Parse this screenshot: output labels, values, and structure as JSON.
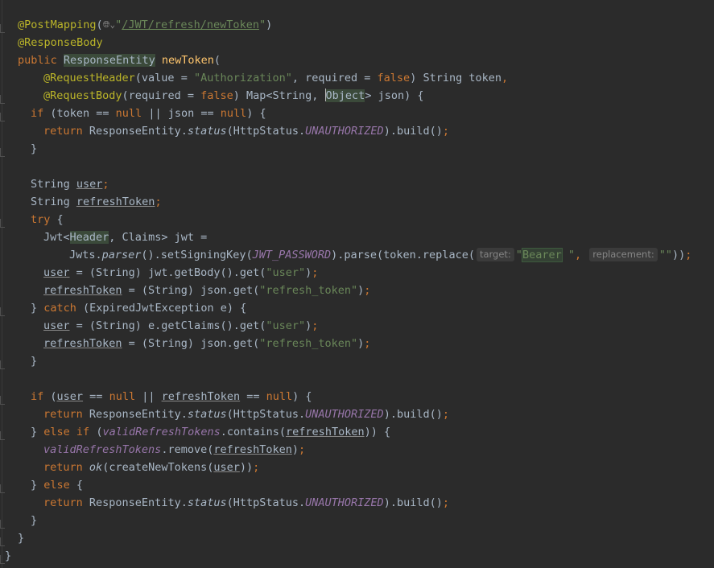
{
  "editor": {
    "mapping_annotation": "@PostMapping",
    "mapping_url": "/JWT/refresh/newToken",
    "response_body_annotation": "@ResponseBody",
    "kw_public": "public",
    "return_type": "ResponseEntity",
    "method_name": "newToken",
    "request_header_annotation": "@RequestHeader",
    "header_value_string": "\"Authorization\"",
    "request_body_annotation": "@RequestBody",
    "kw_false": "false",
    "kw_if": "if",
    "kw_null": "null",
    "kw_return": "return",
    "kw_try": "try",
    "kw_catch": "catch",
    "kw_else": "else",
    "status_method": "status",
    "unauthorized_const": "UNAUTHORIZED",
    "var_user": "user",
    "var_refresh_token": "refreshToken",
    "jwts_parser": "parser",
    "jwt_password_const": "JWT_PASSWORD",
    "hint_target": "target:",
    "hint_replacement": "replacement:",
    "bearer_text": "Bearer",
    "str_user": "\"user\"",
    "str_refresh_token": "\"refresh_token\"",
    "valid_tokens_field": "validRefreshTokens",
    "ok_method": "ok"
  },
  "icons": {
    "globe": "globe-icon"
  }
}
